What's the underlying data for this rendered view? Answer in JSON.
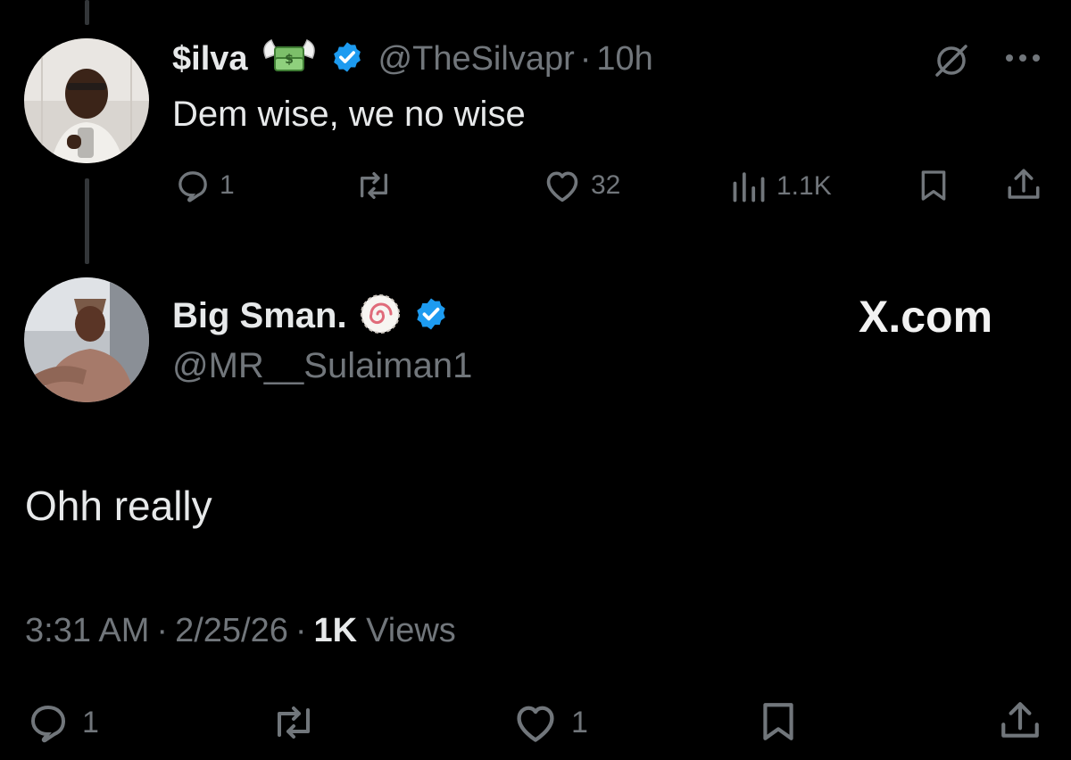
{
  "parent_tweet": {
    "display_name": "$ilva",
    "handle": "@TheSilvapr",
    "separator": "·",
    "time_ago": "10h",
    "text": "Dem wise, we no wise",
    "replies": "1",
    "likes": "32",
    "views": "1.1K"
  },
  "main_tweet": {
    "display_name": "Big Sman.",
    "handle": "@MR__Sulaiman1",
    "watermark": "X.com",
    "text": "Ohh really",
    "time": "3:31 AM",
    "sep1": "·",
    "date": "2/25/26",
    "sep2": "·",
    "views_count": "1K",
    "views_label": "Views",
    "replies": "1",
    "likes": "1"
  },
  "colors": {
    "background": "#000000",
    "text": "#e7e9ea",
    "muted": "#71767b",
    "verified": "#1d9bf0",
    "thread_line": "#333639"
  }
}
